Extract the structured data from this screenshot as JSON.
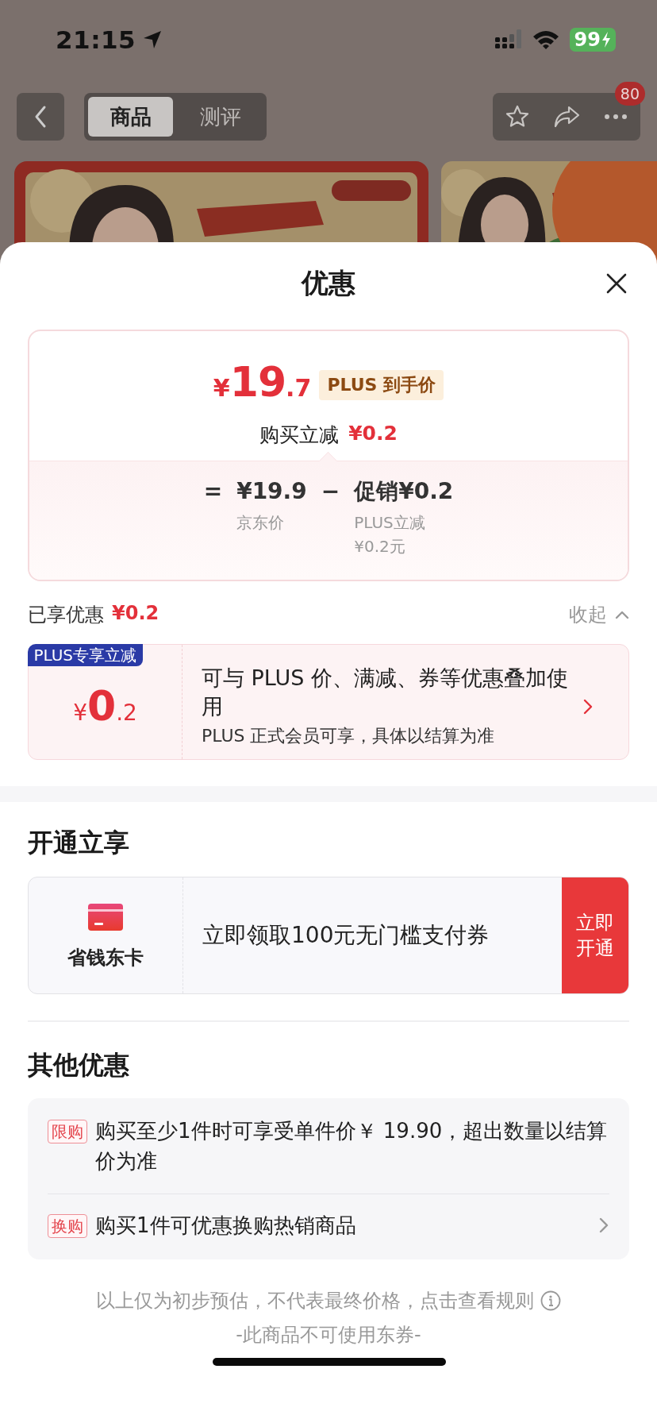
{
  "status_bar": {
    "time": "21:15",
    "battery": "99"
  },
  "nav": {
    "tabs": [
      {
        "label": "商品",
        "selected": true
      },
      {
        "label": "测评",
        "selected": false
      }
    ],
    "badge": "80"
  },
  "sheet": {
    "title": "优惠"
  },
  "price_card": {
    "currency": "¥",
    "integer": "19",
    "decimal": ".7",
    "tag": "PLUS 到手价",
    "reduction_label": "购买立减",
    "reduction_amount": "¥0.2",
    "equals": "=",
    "base_price": "¥19.9",
    "base_label": "京东价",
    "minus": "−",
    "promo": "促销¥0.2",
    "promo_note": "PLUS立减\n¥0.2元"
  },
  "savings": {
    "label": "已享优惠",
    "amount": "¥0.2",
    "toggle": "收起",
    "expanded": true
  },
  "plus_offer": {
    "badge": "PLUS专享立减",
    "currency": "¥",
    "integer": "0",
    "decimal": ".2",
    "title": "可与 PLUS 价、满减、券等优惠叠加使用",
    "note": "PLUS 正式会员可享，具体以结算为准"
  },
  "membership": {
    "heading": "开通立享",
    "card_name": "省钱东卡",
    "offer": "立即领取100元无门槛支付券",
    "button": "立即开通"
  },
  "other": {
    "heading": "其他优惠",
    "items": [
      {
        "kind": "info",
        "tag": "限购",
        "text": "购买至少1件时可享受单件价￥ 19.90，超出数量以结算价为准"
      },
      {
        "kind": "link",
        "tag": "换购",
        "text": "购买1件可优惠换购热销商品"
      }
    ]
  },
  "footer": {
    "notice": "以上仅为初步预估，不代表最终价格，点击查看规则",
    "note": "-此商品不可使用东券-"
  }
}
